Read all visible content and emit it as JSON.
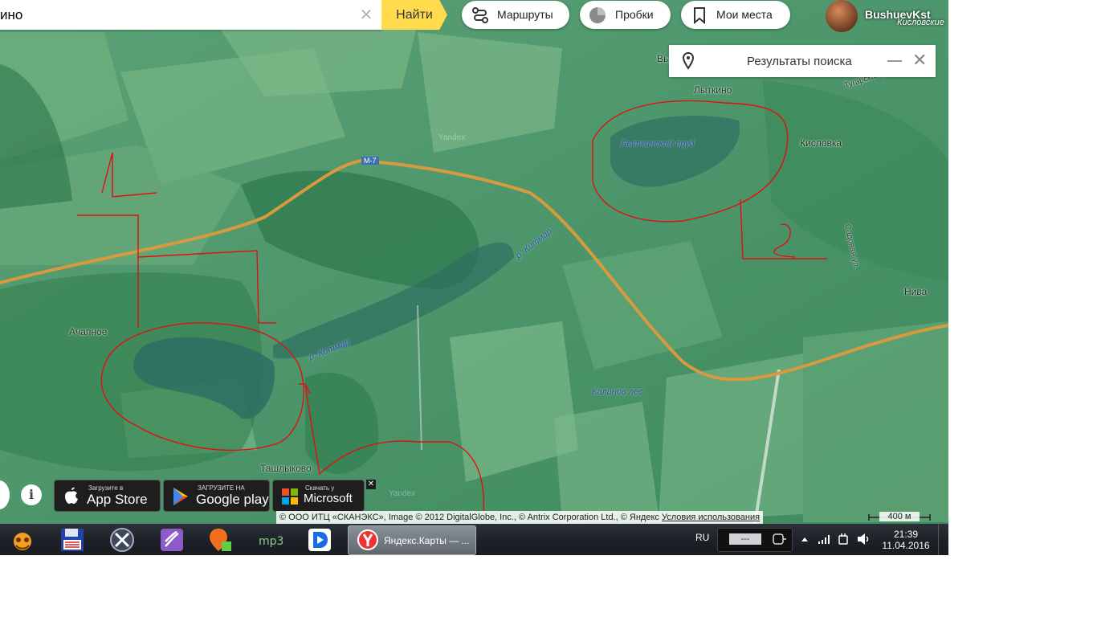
{
  "search": {
    "value": "ино",
    "clear_symbol": "✕",
    "find_label": "Найти"
  },
  "header": {
    "routes_label": "Маршруты",
    "traffic_label": "Пробки",
    "places_label": "Мои места",
    "user_name": "BushuevKst",
    "user_subtitle": "Кисловские"
  },
  "results_panel": {
    "title": "Результаты поиска",
    "partial_label": "Вы"
  },
  "map_labels": {
    "village_lytkino": "Лыткино",
    "lytkino_pond": "Лыткинский пруд",
    "kislovka": "Кисловка",
    "tugarskaya": "Тугарская ул.",
    "sadovaya": "Садовая ул.",
    "niva": "Нива",
    "kitmar_1": "р. Китмар",
    "kitmar_2": "р. Китмар",
    "kalinov_les": "Калинов лес",
    "achapnoe": "Ачапное",
    "tashlykovo": "Ташлыково",
    "highway": "М-7",
    "watermark": "Yandex"
  },
  "stores": {
    "appstore_small": "Загрузите в",
    "appstore_big": "App Store",
    "google_small": "ЗАГРУЗИТЕ НА",
    "google_big": "Google play",
    "ms_small": "Скачать у",
    "ms_big": "Microsoft"
  },
  "copyright": {
    "text": "© ООО ИТЦ «СКАНЭКС», Image © 2012 DigitalGlobe, Inc., © Antrix Corporation Ltd., © Яндекс",
    "terms_link": "Условия использования"
  },
  "scale": {
    "label": "400 м"
  },
  "taskbar": {
    "active_window": "Яндекс.Карты — ...",
    "lang": "RU",
    "tray_box": "---",
    "time": "21:39",
    "date": "11.04.2016"
  },
  "colors": {
    "find_button": "#ffdb4d",
    "road": "#d79a3e",
    "annotation": "#e01010",
    "map_green": "#4f9a6a"
  },
  "icons": [
    "routes-icon",
    "traffic-icon",
    "bookmark-icon",
    "pin-icon",
    "apple-icon",
    "play-icon",
    "microsoft-icon",
    "info-icon"
  ]
}
